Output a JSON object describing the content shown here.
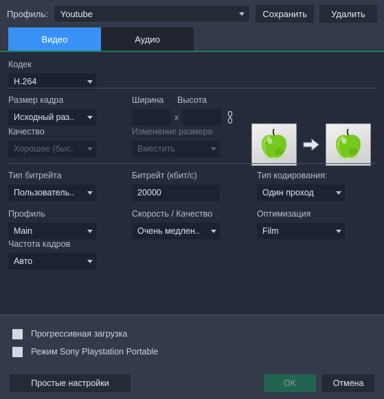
{
  "profile_bar": {
    "label": "Профиль:",
    "selected": "Youtube",
    "save_button": "Сохранить",
    "delete_button": "Удалить"
  },
  "tabs": [
    {
      "label": "Видео",
      "active": true
    },
    {
      "label": "Аудио",
      "active": false
    }
  ],
  "video": {
    "codec": {
      "label": "Кодек",
      "value": "H.264"
    },
    "frame_size": {
      "label": "Размер кадра",
      "value": "Исходный раз.."
    },
    "width": {
      "label": "Ширина",
      "value": "",
      "placeholder": ""
    },
    "height": {
      "label": "Высота",
      "value": "",
      "placeholder": ""
    },
    "dimension_separator": "x",
    "link_icon": "chain-link-icon",
    "quality": {
      "label": "Качество",
      "value": "Хорошее (быс.",
      "disabled": true
    },
    "resize": {
      "label": "Изменение размера",
      "value": "Вместить",
      "disabled": true
    },
    "preview": {
      "before_alt": "apple-thumbnail-before",
      "arrow": "arrow-right-icon",
      "after_alt": "apple-thumbnail-after"
    },
    "bitrate_type": {
      "label": "Тип битрейта",
      "value": "Пользователь.."
    },
    "bitrate": {
      "label": "Битрейт (кбит/с)",
      "value": "20000"
    },
    "encoding_type": {
      "label": "Тип кодирования:",
      "value": "Один проход"
    },
    "profile": {
      "label": "Профиль",
      "value": "Main"
    },
    "speed_quality": {
      "label": "Скорость / Качество",
      "value": "Очень медлен.."
    },
    "optimization": {
      "label": "Оптимизация",
      "value": "Film"
    },
    "framerate": {
      "label": "Частота кадров",
      "value": "Авто"
    }
  },
  "checkboxes": [
    {
      "label": "Прогрессивная загрузка",
      "checked": false
    },
    {
      "label": "Режим Sony Playstation Portable",
      "checked": false
    }
  ],
  "footer": {
    "simple_settings": "Простые настройки",
    "ok": "OK",
    "cancel": "Отмена"
  },
  "colors": {
    "window_bg": "#333a4a",
    "content_bg": "#252b38",
    "tab_active": "#3a91f5",
    "accent_rule": "#1f7a52",
    "ok_button": "#216450",
    "field_bg": "#1c2230"
  }
}
